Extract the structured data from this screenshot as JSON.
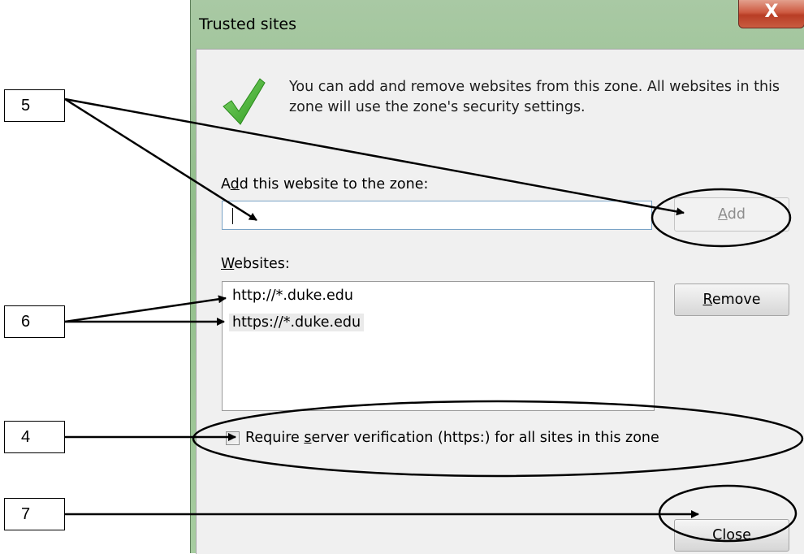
{
  "dialog": {
    "title": "Trusted sites",
    "close_glyph": "X",
    "info_text": "You can add and remove websites from this zone. All websites in this zone will use the zone's security settings.",
    "add_label_pre": "A",
    "add_label_key": "d",
    "add_label_post": "d this website to the zone:",
    "add_input_value": "",
    "add_button": {
      "key": "A",
      "rest": "dd",
      "enabled": false
    },
    "websites_label_key": "W",
    "websites_label_rest": "ebsites:",
    "websites": [
      {
        "url": "http://*.duke.edu",
        "selected": false
      },
      {
        "url": "https://*.duke.edu",
        "selected": true
      }
    ],
    "remove_button": {
      "key": "R",
      "rest": "emove"
    },
    "verify": {
      "checked": false,
      "label_pre": "Require ",
      "label_key": "s",
      "label_post": "erver verification (https:) for all sites in this zone"
    },
    "close_button": {
      "key": "C",
      "rest": "lose"
    },
    "colors": {
      "titlebar": "#a9c9a4",
      "close_button": "#c9472e",
      "client": "#f0f0f0",
      "check": "#3fae2a"
    },
    "icons": [
      "checkmark-icon",
      "close-icon"
    ]
  },
  "callouts": [
    {
      "label": "5"
    },
    {
      "label": "6"
    },
    {
      "label": "4"
    },
    {
      "label": "7"
    }
  ]
}
